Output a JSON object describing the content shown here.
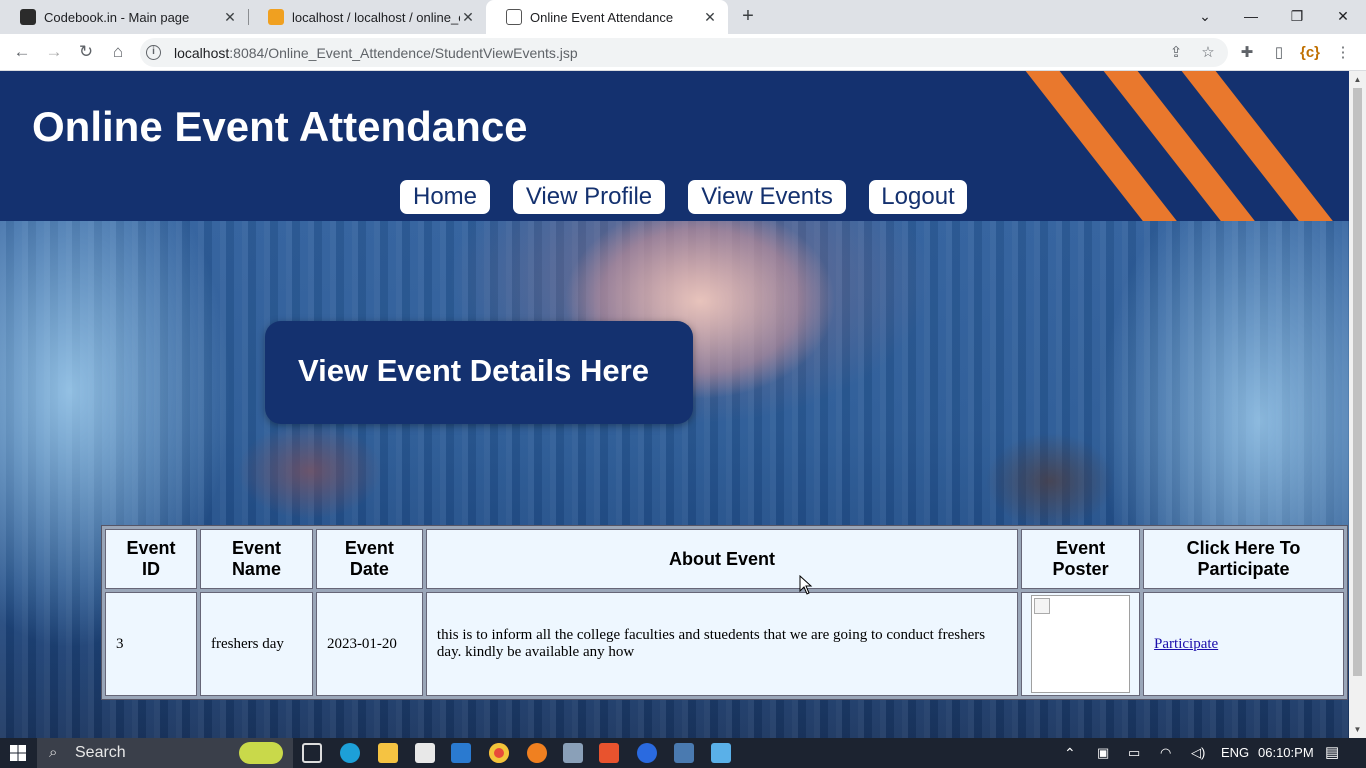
{
  "browser": {
    "tabs": [
      {
        "title": "Codebook.in - Main page",
        "active": false
      },
      {
        "title": "localhost / localhost / online_eve",
        "active": false
      },
      {
        "title": "Online Event Attendance",
        "active": true
      }
    ],
    "url_host": "localhost",
    "url_path": ":8084/Online_Event_Attendence/StudentViewEvents.jsp",
    "window_controls": [
      "chevron-down-icon",
      "minimize-icon",
      "restore-icon",
      "close-icon"
    ]
  },
  "header": {
    "title": "Online Event Attendance",
    "nav": [
      "Home",
      "View Profile",
      "View Events",
      "Logout"
    ],
    "accent_color": "#e9782d",
    "brand_color": "#14316f"
  },
  "main": {
    "heading": "View Event Details Here",
    "table": {
      "headers": [
        "Event ID",
        "Event Name",
        "Event Date",
        "About Event",
        "Event Poster",
        "Click Here To Participate"
      ],
      "rows": [
        {
          "id": "3",
          "name": "freshers day",
          "date": "2023-01-20",
          "about": "this is to inform all the college faculties and stuedents that we are going to conduct freshers day. kindly be available any how",
          "action": "Participate"
        }
      ]
    }
  },
  "taskbar": {
    "search_label": "Search",
    "language": "ENG",
    "time": "06:10:PM"
  }
}
